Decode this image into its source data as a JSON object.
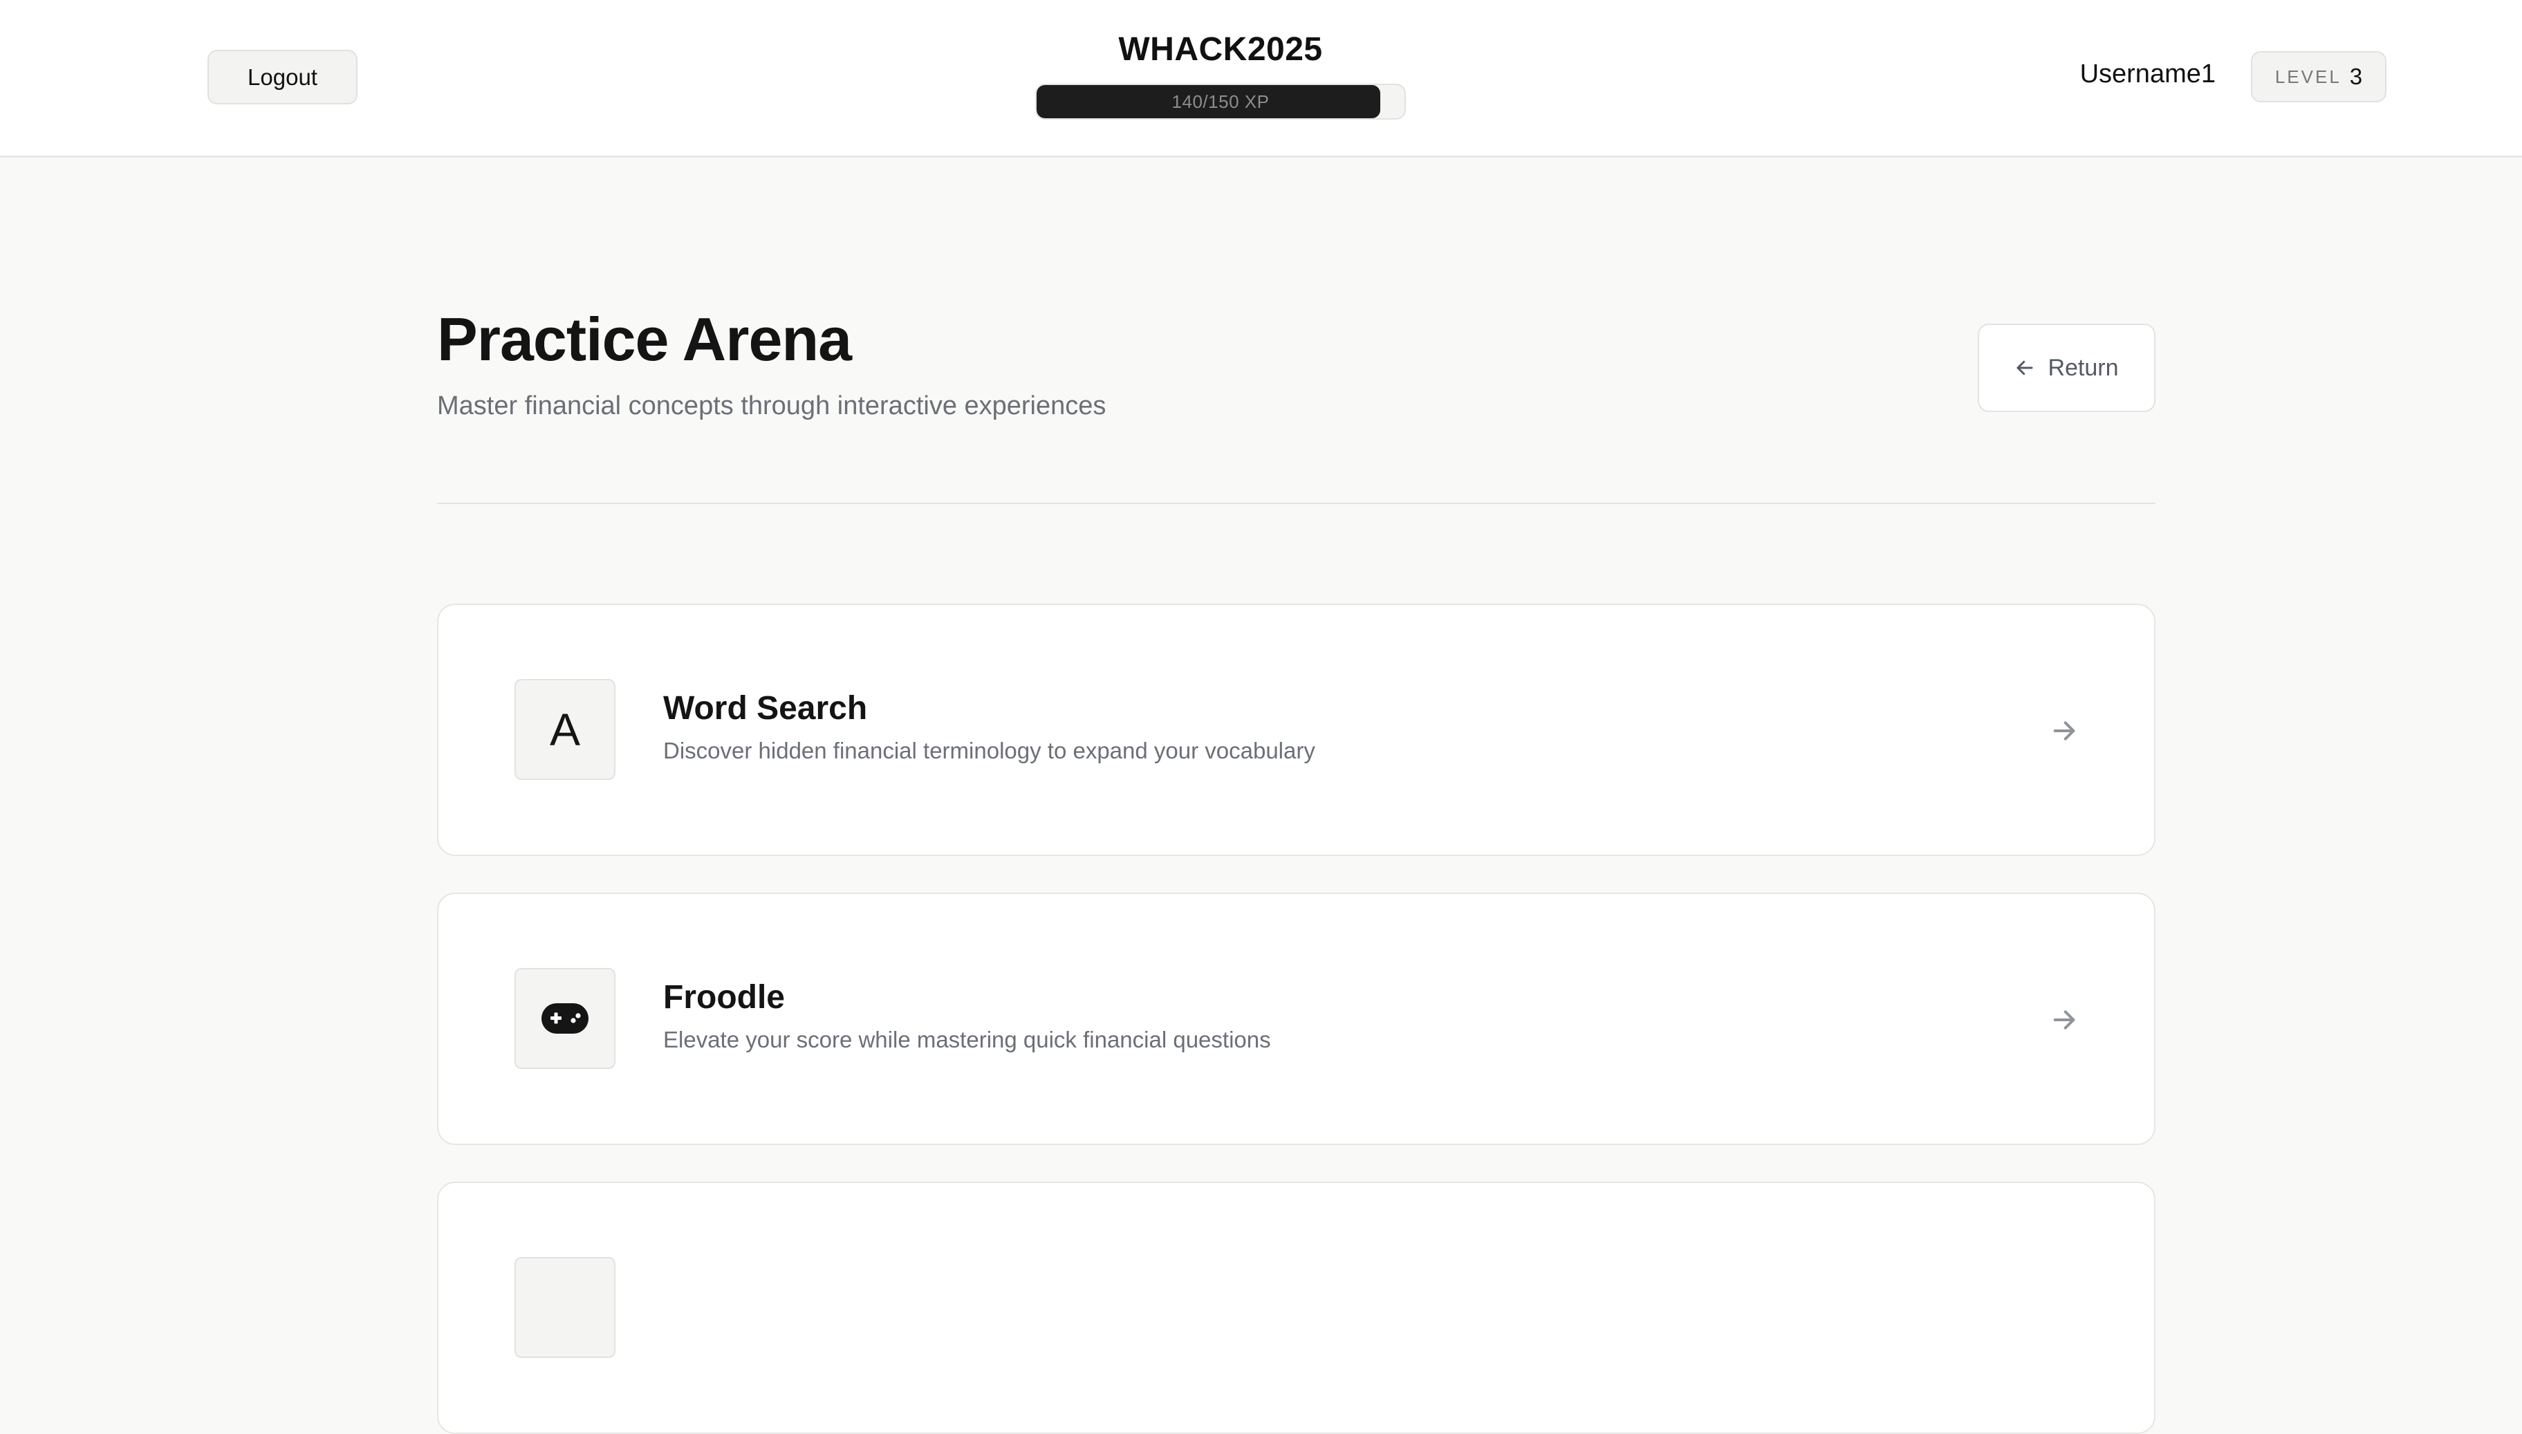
{
  "header": {
    "logout_label": "Logout",
    "brand": "WHACK2025",
    "xp": {
      "current": 140,
      "max": 150,
      "text": "140/150 XP"
    },
    "username": "Username1",
    "level_label": "LEVEL",
    "level_value": "3"
  },
  "main": {
    "title": "Practice Arena",
    "subtitle": "Master financial concepts through interactive experiences",
    "return_label": "Return",
    "games": [
      {
        "title": "Word Search",
        "description": "Discover hidden financial terminology to expand your vocabulary",
        "icon": "letter-a-icon",
        "icon_text": "A"
      },
      {
        "title": "Froodle",
        "description": "Elevate your score while mastering quick financial questions",
        "icon": "gamepad-icon"
      },
      {
        "title": "",
        "description": "",
        "icon": "unknown-icon"
      }
    ]
  },
  "colors": {
    "background": "#f9f9f7",
    "card": "#ffffff",
    "border": "#e6e6e4",
    "text_primary": "#141414",
    "text_muted": "#6b6f76",
    "xp_fill": "#1d1d1d"
  }
}
